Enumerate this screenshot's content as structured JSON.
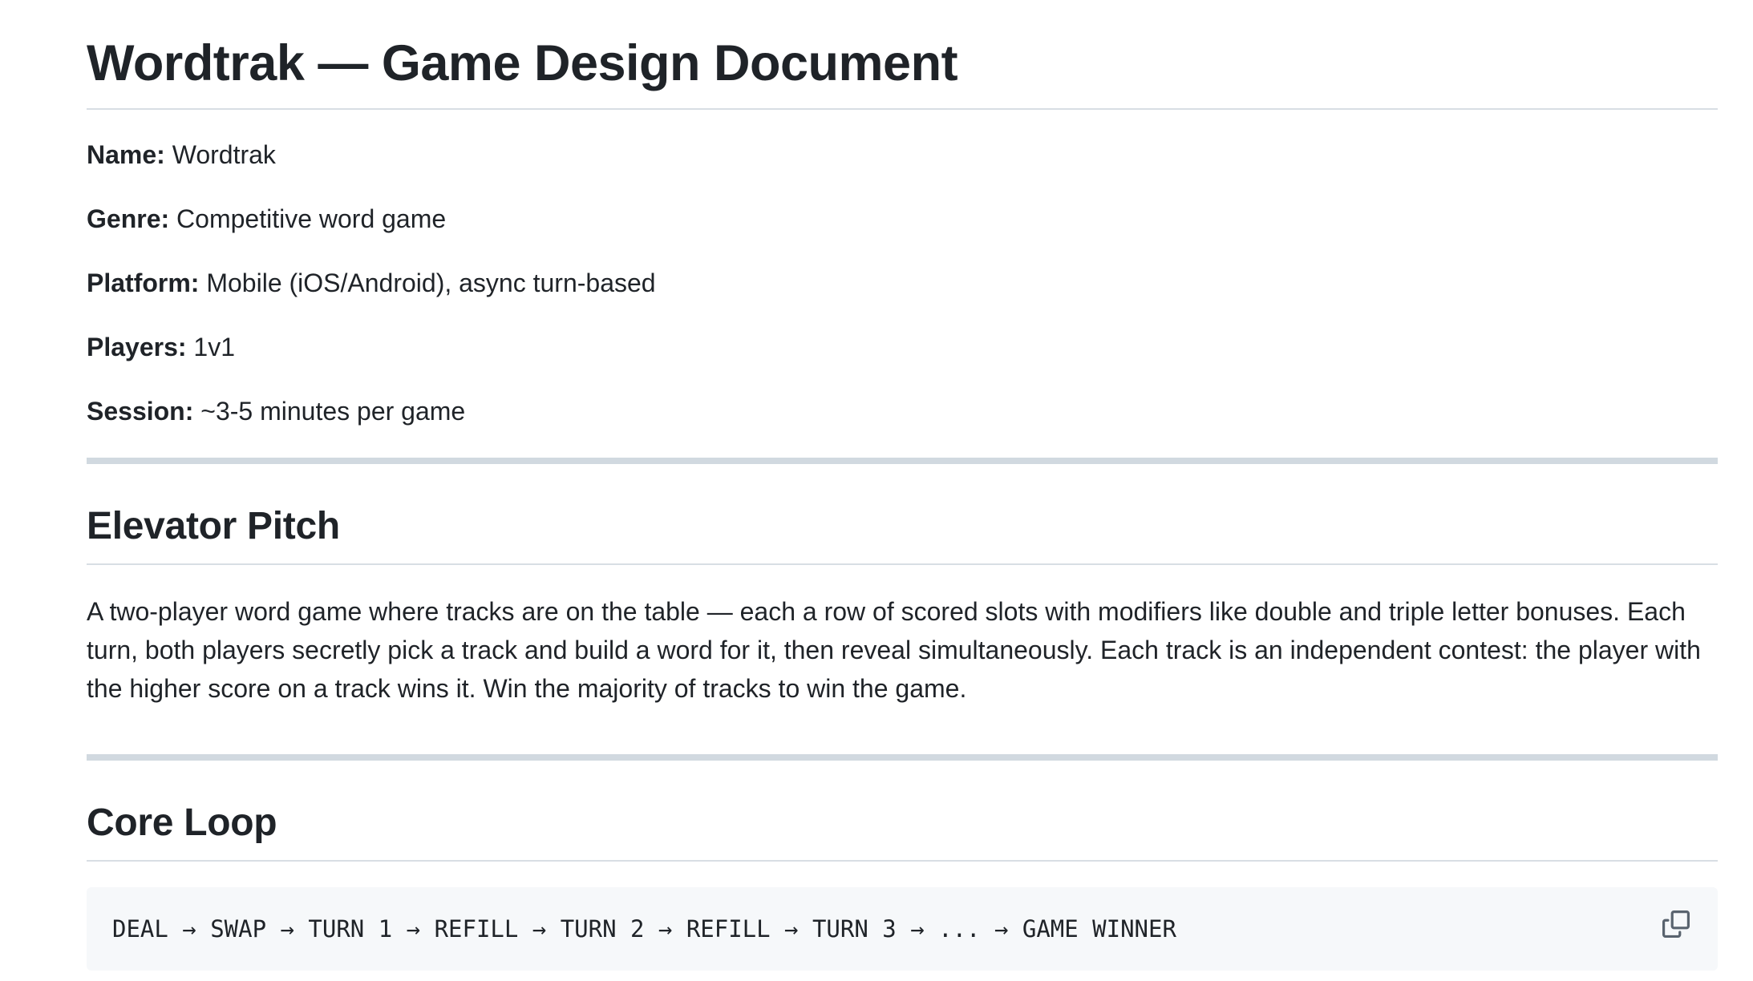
{
  "title": "Wordtrak — Game Design Document",
  "meta": [
    {
      "label": "Name:",
      "value": "Wordtrak"
    },
    {
      "label": "Genre:",
      "value": "Competitive word game"
    },
    {
      "label": "Platform:",
      "value": "Mobile (iOS/Android), async turn-based"
    },
    {
      "label": "Players:",
      "value": "1v1"
    },
    {
      "label": "Session:",
      "value": "~3-5 minutes per game"
    }
  ],
  "elevator_pitch": {
    "heading": "Elevator Pitch",
    "body": "A two-player word game where tracks are on the table — each a row of scored slots with modifiers like double and triple letter bonuses. Each turn, both players secretly pick a track and build a word for it, then reveal simultaneously. Each track is an independent contest: the player with the higher score on a track wins it. Win the majority of tracks to win the game."
  },
  "core_loop": {
    "heading": "Core Loop",
    "code": "DEAL → SWAP → TURN 1 → REFILL → TURN 2 → REFILL → TURN 3 → ... → GAME WINNER",
    "copy_icon": "copy-icon"
  }
}
